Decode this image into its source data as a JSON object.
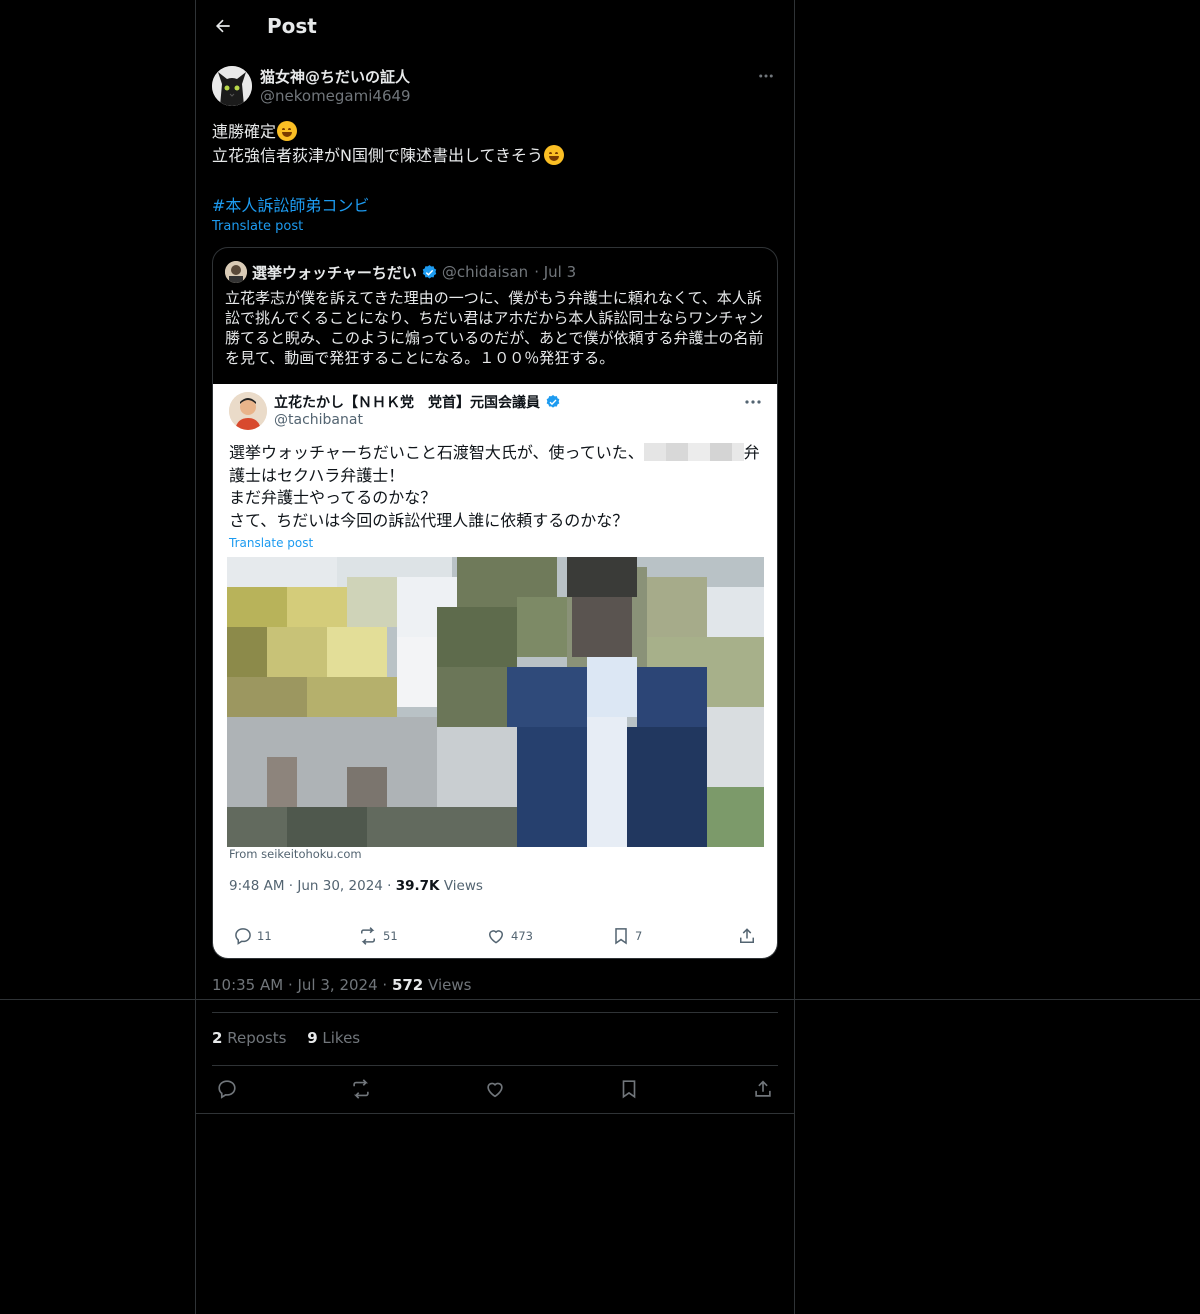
{
  "header": {
    "title": "Post"
  },
  "author": {
    "name": "猫女神@ちだいの証人",
    "handle": "@nekomegami4649"
  },
  "post": {
    "line1": "連勝確定",
    "line2": "立花強信者荻津がN国側で陳述書出してきそう",
    "hashtag": "#本人訴訟師弟コンビ",
    "translate": "Translate post"
  },
  "quote": {
    "name": "選挙ウォッチャーちだい",
    "handle": "@chidaisan",
    "date": "· Jul 3",
    "text": "立花孝志が僕を訴えてきた理由の一つに、僕がもう弁護士に頼れなくて、本人訴訟で挑んでくることになり、ちだい君はアホだから本人訴訟同士ならワンチャン勝てると睨み、このように煽っているのだが、あとで僕が依頼する弁護士の名前を見て、動画で発狂することになる。１００％発狂する。",
    "screenshot": {
      "name": "立花たかし【ＮＨＫ党　党首】元国会議員",
      "handle": "@tachibanat",
      "text_line1a": "選挙ウォッチャーちだいこと石渡智大氏が、使っていた、",
      "text_line1b": "弁",
      "text_line2": "護士はセクハラ弁護士！",
      "text_line3": "まだ弁護士やってるのかな？",
      "text_line4": "さて、ちだいは今回の訴訟代理人誰に依頼するのかな？",
      "translate": "Translate post",
      "from": "From seikeitohoku.com",
      "time": "9:48 AM · Jun 30, 2024 · ",
      "views_count": "39.7K",
      "views_label": " Views",
      "replies": "11",
      "reposts": "51",
      "likes": "473",
      "bookmarks": "7"
    }
  },
  "meta": {
    "time": "10:35 AM · Jul 3, 2024 · ",
    "views_count": "572",
    "views_label": " Views"
  },
  "stats": {
    "reposts_count": "2",
    "reposts_label": "Reposts",
    "likes_count": "9",
    "likes_label": "Likes"
  },
  "colors": {
    "accent": "#1d9bf0",
    "border": "#2f3336",
    "muted": "#71767b",
    "text": "#e7e9ea"
  }
}
